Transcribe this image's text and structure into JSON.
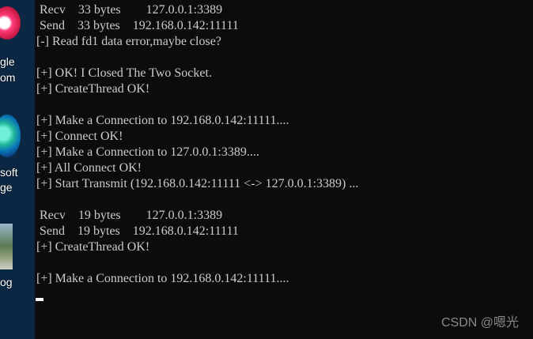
{
  "desktop": {
    "chrome_label_1": "gle",
    "chrome_label_2": "om",
    "edge_label_1": "soft",
    "edge_label_2": "ge",
    "photo_label": "og"
  },
  "terminal": {
    "lines": [
      " Recv    33 bytes        127.0.0.1:3389",
      " Send    33 bytes    192.168.0.142:11111",
      "[-] Read fd1 data error,maybe close?",
      "",
      "[+] OK! I Closed The Two Socket.",
      "[+] CreateThread OK!",
      "",
      "[+] Make a Connection to 192.168.0.142:11111....",
      "[+] Connect OK!",
      "[+] Make a Connection to 127.0.0.1:3389....",
      "[+] All Connect OK!",
      "[+] Start Transmit (192.168.0.142:11111 <-> 127.0.0.1:3389) ...",
      "",
      " Recv    19 bytes        127.0.0.1:3389",
      " Send    19 bytes    192.168.0.142:11111",
      "[+] CreateThread OK!",
      "",
      "[+] Make a Connection to 192.168.0.142:11111...."
    ]
  },
  "watermark": "CSDN @嗯光"
}
